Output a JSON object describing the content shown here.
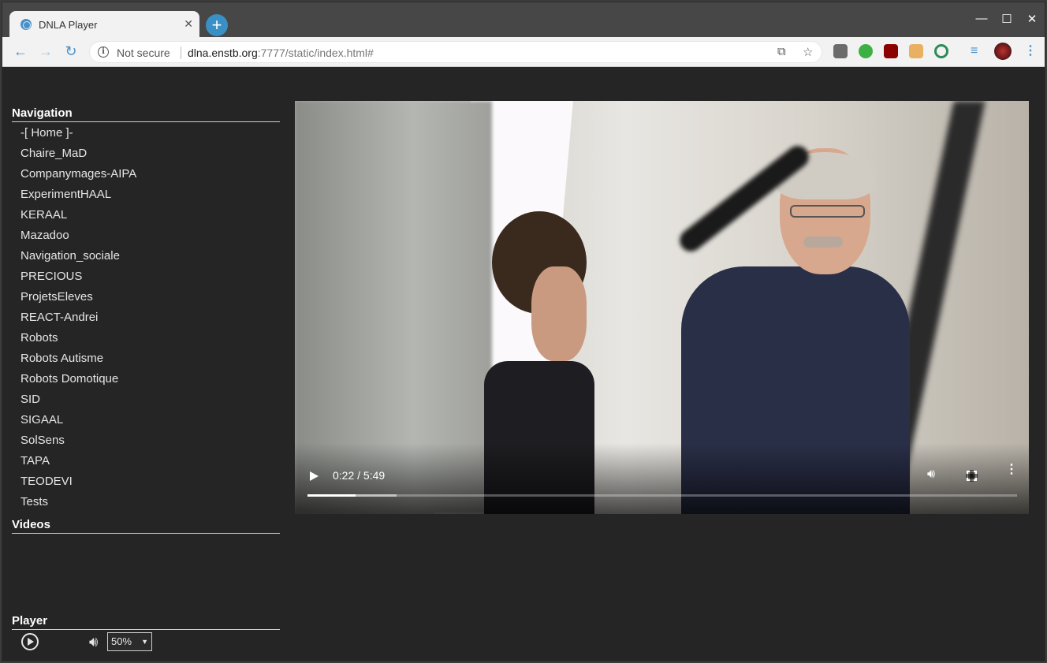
{
  "browser": {
    "tab_title": "DNLA Player",
    "tab_close": "✕",
    "new_tab": "+",
    "window_controls": {
      "minimize": "—",
      "maximize": "☐",
      "close": "✕"
    },
    "omnibox": {
      "security_label": "Not secure",
      "host": "dlna.enstb.org",
      "url_rest": ":7777/static/index.html#"
    }
  },
  "sidebar": {
    "navigation_heading": "Navigation",
    "nav_items": [
      "-[ Home ]-",
      "Chaire_MaD",
      "Companymages-AIPA",
      "ExperimentHAAL",
      "KERAAL",
      "Mazadoo",
      "Navigation_sociale",
      "PRECIOUS",
      "ProjetsEleves",
      "REACT-Andrei",
      "Robots",
      "Robots Autisme",
      "Robots Domotique",
      "SID",
      "SIGAAL",
      "SolSens",
      "TAPA",
      "TEODEVI",
      "Tests"
    ],
    "videos_heading": "Videos",
    "player_heading": "Player",
    "volume_value": "50%"
  },
  "video": {
    "time_display": "0:22 / 5:49",
    "progress_fraction": 0.068,
    "buffered_fraction": 0.126
  }
}
